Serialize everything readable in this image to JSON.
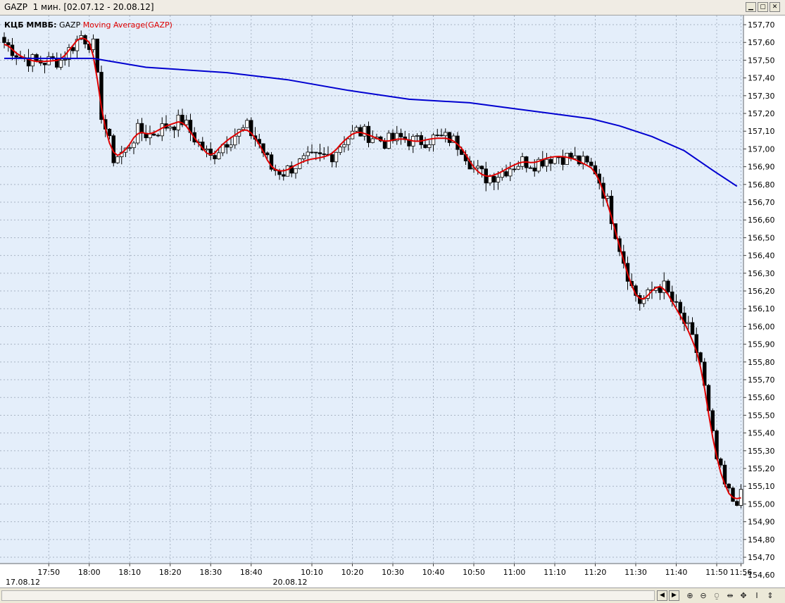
{
  "window": {
    "title": "GAZP  1 мин. [02.07.12 - 20.08.12]",
    "buttons": [
      "▁",
      "▢",
      "✕"
    ]
  },
  "legend": {
    "source": "КЦБ ММВБ:",
    "symbol": "GAZP",
    "indicator": "Moving Average(GAZP)"
  },
  "colors": {
    "background": "#e4eefa",
    "grid": "#a8b4c4",
    "up_candle": "#ffffff",
    "down_candle": "#000000",
    "ma_short": "#e00000",
    "ma_long": "#0000d0"
  },
  "toolbar": {
    "icons": [
      "zoom-in-icon",
      "zoom-out-icon",
      "fit-icon",
      "range-icon",
      "move-icon",
      "cursor-icon",
      "scale-icon"
    ],
    "glyphs": [
      "⊕",
      "⊖",
      "⍜",
      "⇹",
      "✥",
      "I",
      "⇕"
    ]
  },
  "chart_data": {
    "type": "candlestick",
    "title": "",
    "ylim": [
      154.65,
      157.75
    ],
    "y_ticks": [
      "157,70",
      "157,60",
      "157,50",
      "157,40",
      "157,30",
      "157,20",
      "157,10",
      "157,00",
      "156,90",
      "156,80",
      "156,70",
      "156,60",
      "156,50",
      "156,40",
      "156,30",
      "156,20",
      "156,10",
      "156,00",
      "155,90",
      "155,80",
      "155,70",
      "155,60",
      "155,50",
      "155,40",
      "155,30",
      "155,20",
      "155,10",
      "155,00",
      "154,90",
      "154,80",
      "154,70",
      "154,60"
    ],
    "x_ticks": [
      {
        "label": "17:50",
        "bar": 11
      },
      {
        "label": "18:00",
        "bar": 21
      },
      {
        "label": "18:10",
        "bar": 31
      },
      {
        "label": "18:20",
        "bar": 41
      },
      {
        "label": "18:30",
        "bar": 51
      },
      {
        "label": "18:40",
        "bar": 61
      },
      {
        "label": "10:10",
        "bar": 76
      },
      {
        "label": "10:20",
        "bar": 86
      },
      {
        "label": "10:30",
        "bar": 96
      },
      {
        "label": "10:40",
        "bar": 106
      },
      {
        "label": "10:50",
        "bar": 116
      },
      {
        "label": "11:00",
        "bar": 126
      },
      {
        "label": "11:10",
        "bar": 136
      },
      {
        "label": "11:20",
        "bar": 146
      },
      {
        "label": "11:30",
        "bar": 156
      },
      {
        "label": "11:40",
        "bar": 166
      },
      {
        "label": "11:50",
        "bar": 176
      },
      {
        "label": "11:56",
        "bar": 182
      }
    ],
    "date_labels": [
      {
        "label": "17.08.12",
        "bar": 0
      },
      {
        "label": "20.08.12",
        "bar": 66
      }
    ],
    "series": [
      {
        "name": "GAZP",
        "kind": "candles"
      },
      {
        "name": "Moving Average(GAZP)",
        "kind": "line"
      }
    ],
    "long_ma": [
      {
        "bar": 0,
        "v": 157.51
      },
      {
        "bar": 22,
        "v": 157.51
      },
      {
        "bar": 35,
        "v": 157.46
      },
      {
        "bar": 55,
        "v": 157.43
      },
      {
        "bar": 70,
        "v": 157.39
      },
      {
        "bar": 85,
        "v": 157.33
      },
      {
        "bar": 100,
        "v": 157.28
      },
      {
        "bar": 115,
        "v": 157.26
      },
      {
        "bar": 125,
        "v": 157.23
      },
      {
        "bar": 135,
        "v": 157.2
      },
      {
        "bar": 145,
        "v": 157.17
      },
      {
        "bar": 152,
        "v": 157.13
      },
      {
        "bar": 160,
        "v": 157.07
      },
      {
        "bar": 168,
        "v": 156.99
      },
      {
        "bar": 175,
        "v": 156.88
      },
      {
        "bar": 181,
        "v": 156.79
      }
    ],
    "anchors": [
      {
        "bar": 0,
        "v": 157.6
      },
      {
        "bar": 4,
        "v": 157.52
      },
      {
        "bar": 8,
        "v": 157.49
      },
      {
        "bar": 14,
        "v": 157.5
      },
      {
        "bar": 19,
        "v": 157.64
      },
      {
        "bar": 22,
        "v": 157.58
      },
      {
        "bar": 24,
        "v": 157.2
      },
      {
        "bar": 27,
        "v": 156.95
      },
      {
        "bar": 30,
        "v": 156.99
      },
      {
        "bar": 33,
        "v": 157.1
      },
      {
        "bar": 36,
        "v": 157.08
      },
      {
        "bar": 40,
        "v": 157.13
      },
      {
        "bar": 44,
        "v": 157.16
      },
      {
        "bar": 48,
        "v": 157.03
      },
      {
        "bar": 51,
        "v": 156.95
      },
      {
        "bar": 54,
        "v": 157.03
      },
      {
        "bar": 57,
        "v": 157.08
      },
      {
        "bar": 60,
        "v": 157.12
      },
      {
        "bar": 63,
        "v": 157.03
      },
      {
        "bar": 66,
        "v": 156.89
      },
      {
        "bar": 69,
        "v": 156.87
      },
      {
        "bar": 72,
        "v": 156.91
      },
      {
        "bar": 75,
        "v": 156.94
      },
      {
        "bar": 78,
        "v": 156.95
      },
      {
        "bar": 81,
        "v": 156.97
      },
      {
        "bar": 84,
        "v": 157.05
      },
      {
        "bar": 87,
        "v": 157.1
      },
      {
        "bar": 90,
        "v": 157.08
      },
      {
        "bar": 94,
        "v": 157.04
      },
      {
        "bar": 98,
        "v": 157.06
      },
      {
        "bar": 102,
        "v": 157.04
      },
      {
        "bar": 106,
        "v": 157.06
      },
      {
        "bar": 110,
        "v": 157.06
      },
      {
        "bar": 113,
        "v": 157.01
      },
      {
        "bar": 116,
        "v": 156.89
      },
      {
        "bar": 119,
        "v": 156.84
      },
      {
        "bar": 122,
        "v": 156.86
      },
      {
        "bar": 125,
        "v": 156.9
      },
      {
        "bar": 128,
        "v": 156.93
      },
      {
        "bar": 131,
        "v": 156.92
      },
      {
        "bar": 134,
        "v": 156.95
      },
      {
        "bar": 137,
        "v": 156.96
      },
      {
        "bar": 140,
        "v": 156.95
      },
      {
        "bar": 143,
        "v": 156.92
      },
      {
        "bar": 146,
        "v": 156.88
      },
      {
        "bar": 149,
        "v": 156.7
      },
      {
        "bar": 152,
        "v": 156.45
      },
      {
        "bar": 155,
        "v": 156.22
      },
      {
        "bar": 157,
        "v": 156.14
      },
      {
        "bar": 159,
        "v": 156.17
      },
      {
        "bar": 161,
        "v": 156.23
      },
      {
        "bar": 163,
        "v": 156.22
      },
      {
        "bar": 166,
        "v": 156.1
      },
      {
        "bar": 169,
        "v": 155.98
      },
      {
        "bar": 172,
        "v": 155.8
      },
      {
        "bar": 174,
        "v": 155.5
      },
      {
        "bar": 176,
        "v": 155.25
      },
      {
        "bar": 178,
        "v": 155.1
      },
      {
        "bar": 180,
        "v": 155.02
      },
      {
        "bar": 182,
        "v": 155.04
      }
    ]
  }
}
